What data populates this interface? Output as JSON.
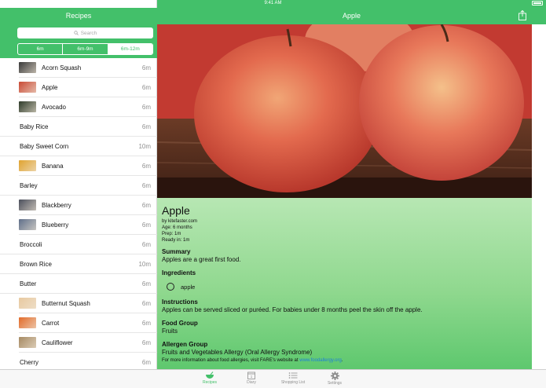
{
  "status_bar": {
    "device": "iPad",
    "time": "9:41 AM"
  },
  "sidebar": {
    "title": "Recipes",
    "search_placeholder": "Search",
    "segments": [
      {
        "label": "6m",
        "active": false
      },
      {
        "label": "6m-9m",
        "active": false
      },
      {
        "label": "6m-12m",
        "active": true
      }
    ],
    "items": [
      {
        "name": "Acorn Squash",
        "time": "6m",
        "thumb": "#3a3a3a"
      },
      {
        "name": "Apple",
        "time": "6m",
        "thumb": "#c94a35"
      },
      {
        "name": "Avocado",
        "time": "6m",
        "thumb": "#2e3b2a"
      },
      {
        "name": "Baby Rice",
        "time": "6m",
        "thumb": null
      },
      {
        "name": "Baby Sweet Corn",
        "time": "10m",
        "thumb": null
      },
      {
        "name": "Banana",
        "time": "6m",
        "thumb": "#e0a32f"
      },
      {
        "name": "Barley",
        "time": "6m",
        "thumb": null
      },
      {
        "name": "Blackberry",
        "time": "6m",
        "thumb": "#4b4f5c"
      },
      {
        "name": "Blueberry",
        "time": "6m",
        "thumb": "#5f6f8a"
      },
      {
        "name": "Broccoli",
        "time": "6m",
        "thumb": null
      },
      {
        "name": "Brown Rice",
        "time": "10m",
        "thumb": null
      },
      {
        "name": "Butter",
        "time": "6m",
        "thumb": null
      },
      {
        "name": "Butternut Squash",
        "time": "6m",
        "thumb": "#e8c9a0"
      },
      {
        "name": "Carrot",
        "time": "6m",
        "thumb": "#e26b2a"
      },
      {
        "name": "Cauliflower",
        "time": "6m",
        "thumb": "#a68a63"
      },
      {
        "name": "Cherry",
        "time": "6m",
        "thumb": null
      }
    ]
  },
  "detail": {
    "header_title": "Apple",
    "title": "Apple",
    "source": "by kitefaster.com",
    "age": "Age: 6 months",
    "prep": "Prep: 1m",
    "ready": "Ready in: 1m",
    "summary_heading": "Summary",
    "summary_text": "Apples are a great first food.",
    "ingredients_heading": "Ingredients",
    "ingredient": "apple",
    "instructions_heading": "Instructions",
    "instructions_text": "Apples can be served sliced or puréed.  For babies under 8 months peel the skin off the apple.",
    "food_group_heading": "Food Group",
    "food_group_text": "Fruits",
    "allergen_heading": "Allergen Group",
    "allergen_text": "Fruits and Vegetables Allergy (Oral Allergy Syndrome)",
    "allergy_note": "For more information about food allergies, visit FARE's website at",
    "allergy_link": "www.foodallergy.org",
    "allergy_note_end": "."
  },
  "tabbar": {
    "tabs": [
      {
        "label": "Recipes",
        "icon": "bowl-icon",
        "active": true
      },
      {
        "label": "Diary",
        "icon": "calendar-icon",
        "active": false
      },
      {
        "label": "Shopping List",
        "icon": "list-icon",
        "active": false
      },
      {
        "label": "Settings",
        "icon": "gear-icon",
        "active": false
      }
    ]
  },
  "colors": {
    "accent": "#43c06a",
    "link": "#1e7fd9"
  }
}
